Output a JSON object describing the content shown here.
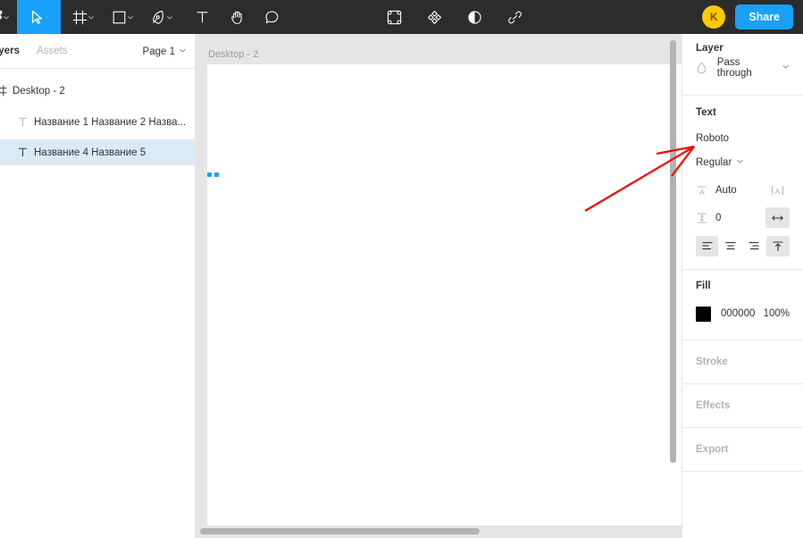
{
  "toolbar": {
    "tools": [
      {
        "name": "main-menu",
        "icon": "figma-menu-icon",
        "caret": true,
        "active": false
      },
      {
        "name": "move-tool",
        "icon": "cursor-icon",
        "caret": true,
        "active": true
      },
      {
        "name": "frame-tool",
        "icon": "frame-icon",
        "caret": true,
        "active": false
      },
      {
        "name": "shape-tool",
        "icon": "square-icon",
        "caret": true,
        "active": false
      },
      {
        "name": "pen-tool",
        "icon": "pen-icon",
        "caret": true,
        "active": false
      },
      {
        "name": "text-tool",
        "icon": "text-t-icon",
        "caret": false,
        "active": false
      },
      {
        "name": "hand-tool",
        "icon": "hand-icon",
        "caret": false,
        "active": false
      },
      {
        "name": "comment-tool",
        "icon": "comment-bubble-icon",
        "caret": false,
        "active": false
      }
    ],
    "center_tools": [
      {
        "name": "component-tool",
        "icon": "component-icon"
      },
      {
        "name": "plugins-tool",
        "icon": "plugin-diamond-icon"
      },
      {
        "name": "mask-tool",
        "icon": "contrast-circle-icon"
      },
      {
        "name": "link-tool",
        "icon": "link-chain-icon"
      }
    ],
    "avatar_initial": "K",
    "avatar_color": "#ffc800",
    "share_label": "Share",
    "share_color": "#18a0fb",
    "background": "#2c2c2c"
  },
  "left_panel": {
    "tabs": [
      {
        "label": "ayers",
        "active": true
      },
      {
        "label": "Assets",
        "active": false
      }
    ],
    "page_selector": "Page 1",
    "layers": [
      {
        "icon": "frame-hash-icon",
        "name": "Desktop - 2",
        "level": 0,
        "selected": false
      },
      {
        "icon": "text-t-icon",
        "name": "Название 1 Название 2 Назва...",
        "level": 1,
        "selected": false
      },
      {
        "icon": "text-t-icon",
        "name": "Название 4 Название 5",
        "level": 1,
        "selected": true
      }
    ],
    "selection_color": "#daeaf7"
  },
  "canvas": {
    "frame_label": "Desktop - 2",
    "background": "#e5e5e5",
    "frame_fill": "#ffffff"
  },
  "right_panel": {
    "layer": {
      "title": "Layer",
      "blend_mode": "Pass through",
      "blend_icon": "blend-drop-icon"
    },
    "text": {
      "title": "Text",
      "font_family": "Roboto",
      "font_style": "Regular",
      "font_size_icon": "font-size-icon",
      "font_size": "Auto",
      "resize_icon": "text-resize-icon",
      "line_height_icon": "line-height-icon",
      "line_height": "0",
      "letter_spacing_icon": "letter-spacing-icon",
      "align": [
        {
          "name": "align-left",
          "icon": "align-left-icon",
          "active": true
        },
        {
          "name": "align-center",
          "icon": "align-center-icon",
          "active": false
        },
        {
          "name": "align-right",
          "icon": "align-right-icon",
          "active": false
        }
      ],
      "vertical_align": {
        "name": "align-top",
        "icon": "align-top-icon",
        "active": true
      }
    },
    "fill": {
      "title": "Fill",
      "swatch_color": "#000000",
      "hex": "000000",
      "opacity": "100%"
    },
    "sections": [
      {
        "title": "Stroke"
      },
      {
        "title": "Effects"
      },
      {
        "title": "Export"
      }
    ]
  },
  "annotation": {
    "color": "#ff0000",
    "description": "red-arrow-pointing-to-font-family"
  }
}
